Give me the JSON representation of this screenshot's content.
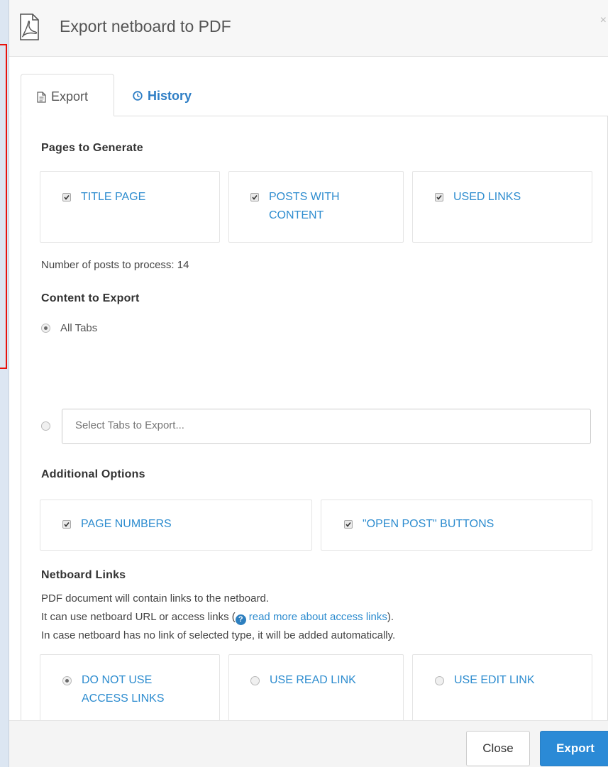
{
  "window": {
    "title": "Export netboard to PDF",
    "close_glyph": "×"
  },
  "tabs": [
    {
      "label": "Export",
      "icon": "document-icon",
      "active": true
    },
    {
      "label": "History",
      "icon": "clock-icon",
      "active": false
    }
  ],
  "pages_to_generate": {
    "title": "Pages to Generate",
    "options": [
      {
        "label": "Title Page",
        "checked": true
      },
      {
        "label": "Posts with Content",
        "checked": true
      },
      {
        "label": "Used Links",
        "checked": true
      }
    ],
    "posts_count_label": "Number of posts to process: 14"
  },
  "content_to_export": {
    "title": "Content to Export",
    "all_tabs_label": "All Tabs",
    "select_placeholder": "Select Tabs to Export...",
    "selected": "All Tabs"
  },
  "additional_options": {
    "title": "Additional Options",
    "options": [
      {
        "label": "Page Numbers",
        "checked": true
      },
      {
        "label": "\"Open Post\" Buttons",
        "checked": true
      }
    ]
  },
  "netboard_links": {
    "title": "Netboard Links",
    "line1": "PDF document will contain links to the netboard.",
    "line2_prefix": "It can use netboard URL or access links (",
    "line2_link": "read more about access links",
    "line2_suffix": ").",
    "line3": "In case netboard has no link of selected type, it will be added automatically.",
    "options": [
      {
        "label": "Do not use access links",
        "selected": true
      },
      {
        "label": "Use read link",
        "selected": false
      },
      {
        "label": "Use edit link",
        "selected": false
      }
    ]
  },
  "footer": {
    "close_label": "Close",
    "export_label": "Export"
  },
  "colors": {
    "link": "#2d8ccf",
    "primary_button": "#2b8ad6",
    "marker": "#e8120c"
  }
}
